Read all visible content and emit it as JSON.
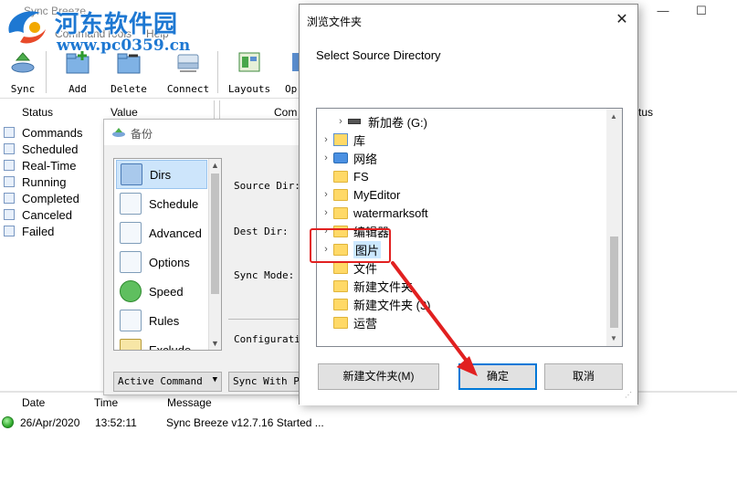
{
  "main_window": {
    "title": "Sync Breeze",
    "menu": [
      "Command",
      "Tools",
      "Help"
    ],
    "toolbar": [
      "Sync",
      "Add",
      "Delete",
      "Connect",
      "Layouts",
      "Op"
    ],
    "status_headers": {
      "status": "Status",
      "value": "Value",
      "command": "Com",
      "status_right": "tus"
    },
    "status_items": [
      "Commands",
      "Scheduled",
      "Real-Time",
      "Running",
      "Completed",
      "Canceled",
      "Failed"
    ],
    "log_headers": {
      "date": "Date",
      "time": "Time",
      "message": "Message"
    },
    "log_row": {
      "date": "26/Apr/2020",
      "time": "13:52:11",
      "message": "Sync Breeze v12.7.16 Started ..."
    }
  },
  "watermark": {
    "line1": "河东软件园",
    "line2": "www.pc0359.cn"
  },
  "backup_dialog": {
    "title": "备份",
    "nav_items": [
      "Dirs",
      "Schedule",
      "Advanced",
      "Options",
      "Speed",
      "Rules",
      "Exclude"
    ],
    "selected_nav": "Dirs",
    "fields": {
      "source_dir": "Source Dir:",
      "dest_dir": "Dest Dir:",
      "sync_mode": "Sync Mode:",
      "configuration": "Configuratio"
    },
    "combo_active": "Active Command",
    "combo_sync": "Sync With Pr"
  },
  "browse_dialog": {
    "title": "浏览文件夹",
    "description": "Select Source Directory",
    "tree": [
      {
        "label": "新加卷 (G:)",
        "icon": "drive-icon",
        "chevron": true,
        "indent": 1
      },
      {
        "label": "库",
        "icon": "library-icon",
        "chevron": true,
        "indent": 0
      },
      {
        "label": "网络",
        "icon": "network-icon",
        "chevron": true,
        "indent": 0
      },
      {
        "label": "FS",
        "icon": "folder-icon",
        "chevron": false,
        "indent": 0
      },
      {
        "label": "MyEditor",
        "icon": "folder-icon",
        "chevron": true,
        "indent": 0
      },
      {
        "label": "watermarksoft",
        "icon": "folder-icon",
        "chevron": true,
        "indent": 0
      },
      {
        "label": "编辑器",
        "icon": "folder-icon",
        "chevron": true,
        "indent": 0
      },
      {
        "label": "图片",
        "icon": "folder-icon",
        "chevron": true,
        "indent": 0,
        "selected": true
      },
      {
        "label": "文件",
        "icon": "folder-icon",
        "chevron": false,
        "indent": 0
      },
      {
        "label": "新建文件夹",
        "icon": "folder-icon",
        "chevron": false,
        "indent": 0
      },
      {
        "label": "新建文件夹 (3)",
        "icon": "folder-icon",
        "chevron": false,
        "indent": 0
      },
      {
        "label": "运营",
        "icon": "folder-icon",
        "chevron": false,
        "indent": 0
      }
    ],
    "buttons": {
      "new_folder": "新建文件夹(M)",
      "ok": "确定",
      "cancel": "取消"
    }
  },
  "colors": {
    "accent": "#0078d7",
    "highlight": "#e12020",
    "selection": "#cce8ff",
    "watermark": "#1e78d2"
  }
}
